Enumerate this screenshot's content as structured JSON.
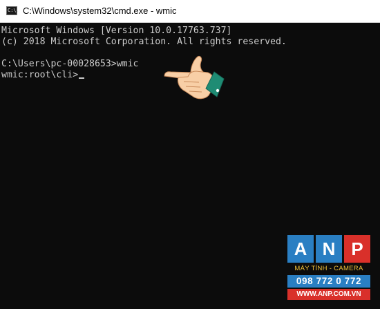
{
  "window": {
    "title": "C:\\Windows\\system32\\cmd.exe - wmic",
    "icon": "cmd-icon",
    "icon_text": "C:\\."
  },
  "console": {
    "lines": [
      "Microsoft Windows [Version 10.0.17763.737]",
      "(c) 2018 Microsoft Corporation. All rights reserved.",
      "",
      "C:\\Users\\pc-00028653>wmic",
      "wmic:root\\cli>"
    ],
    "text_color": "#cccccc",
    "background": "#0c0c0c"
  },
  "overlay": {
    "pointer_icon": "pointing-hand-icon"
  },
  "watermark": {
    "letters": [
      "A",
      "N",
      "P"
    ],
    "tagline": "MÁY TÍNH - CAMERA",
    "phone": "098 772 0 772",
    "website": "WWW.ANP.COM.VN",
    "colors": {
      "blue": "#2a7fc3",
      "red": "#d9302a",
      "gold": "#f2c23a"
    }
  }
}
